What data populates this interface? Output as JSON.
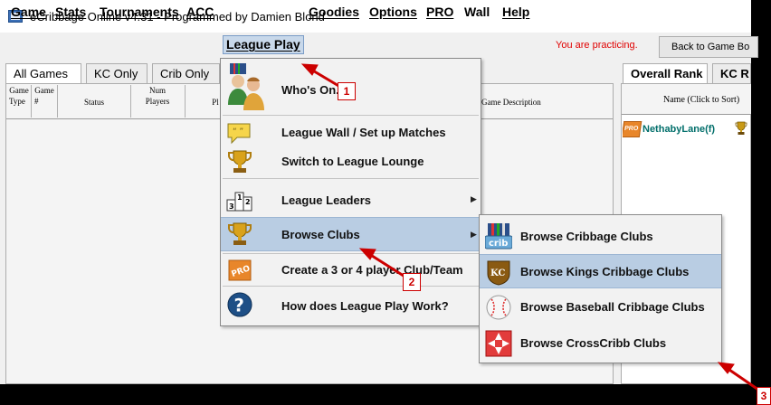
{
  "window": {
    "title": "eCribbage Online v4.31 - Programmed by Damien Blond"
  },
  "menubar": {
    "items": [
      "Game",
      "Stats",
      "Tournaments",
      "ACC",
      "League Play",
      "Goodies",
      "Options",
      "PRO",
      "Wall",
      "Help"
    ],
    "status_text": "You are practicing.",
    "back_button": "Back to Game Bo"
  },
  "left_tabs": [
    "All Games",
    "KC Only",
    "Crib Only"
  ],
  "right_tabs": [
    "Overall Rank",
    "KC R"
  ],
  "games_table": {
    "headers": {
      "game_type": [
        "Game",
        "Type"
      ],
      "game_num": [
        "Game",
        "#"
      ],
      "status": "Status",
      "num_players": [
        "Num",
        "Players"
      ],
      "players": "Pl",
      "game_description": "Game Description"
    }
  },
  "rank_panel": {
    "header": "Name (Click to Sort)",
    "rows": [
      {
        "badge": "PRO",
        "name": "NethabyLane(f)"
      }
    ]
  },
  "league_menu": {
    "items": [
      {
        "label": "Who's On...?",
        "icon": "people-icon",
        "submenu": false
      },
      {
        "label": "League Wall / Set up Matches",
        "icon": "speech-bubble-icon",
        "submenu": false
      },
      {
        "label": "Switch to League Lounge",
        "icon": "trophy-icon",
        "submenu": false
      },
      {
        "label": "League Leaders",
        "icon": "podium-icon",
        "submenu": true
      },
      {
        "label": "Browse Clubs",
        "icon": "trophy-icon",
        "submenu": true
      },
      {
        "label": "Create a 3 or 4 player Club/Team",
        "icon": "pro-icon",
        "submenu": false
      },
      {
        "label": "How does League Play Work?",
        "icon": "help-icon",
        "submenu": false
      }
    ]
  },
  "clubs_submenu": {
    "items": [
      {
        "label": "Browse Cribbage Clubs",
        "icon": "crib-icon"
      },
      {
        "label": "Browse Kings Cribbage Clubs",
        "icon": "kings-cribbage-icon"
      },
      {
        "label": "Browse Baseball Cribbage Clubs",
        "icon": "baseball-icon"
      },
      {
        "label": "Browse CrossCribb Clubs",
        "icon": "crosscribb-icon"
      }
    ]
  },
  "callouts": [
    "1",
    "2",
    "3"
  ],
  "colors": {
    "menu_highlight": "#b9cde3",
    "callout_red": "#cc0000",
    "status_red": "#e00000",
    "player_name": "#006e6a",
    "pro_orange": "#e8862a"
  }
}
